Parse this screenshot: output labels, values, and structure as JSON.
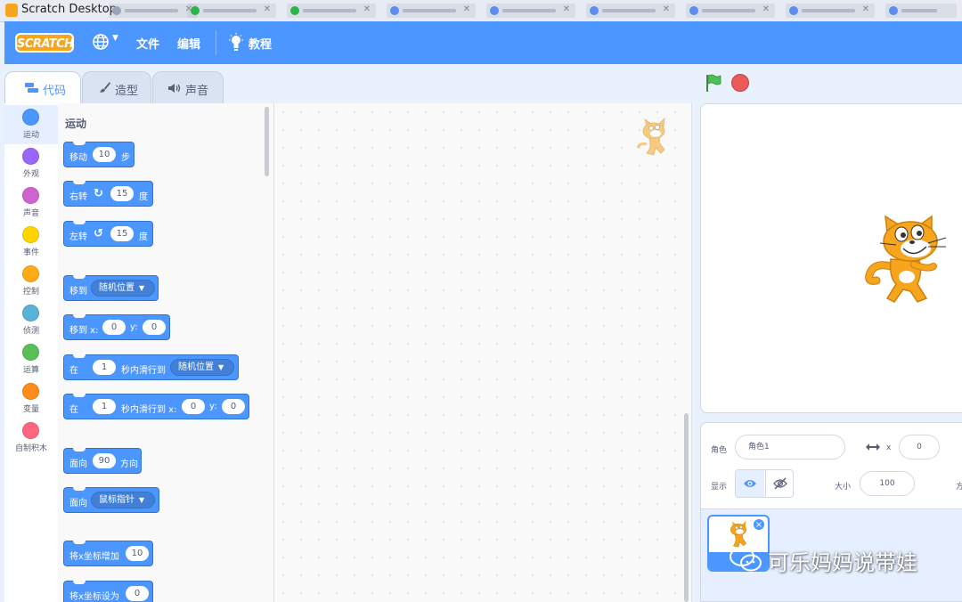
{
  "window": {
    "title": "Scratch Desktop"
  },
  "menubar": {
    "logo": "SCRATCH",
    "file": "文件",
    "edit": "编辑",
    "tutorials": "教程"
  },
  "tabs": [
    {
      "label": "代码",
      "active": true
    },
    {
      "label": "造型",
      "active": false
    },
    {
      "label": "声音",
      "active": false
    }
  ],
  "categories": [
    {
      "label": "运动",
      "color": "#4c97ff",
      "active": true
    },
    {
      "label": "外观",
      "color": "#9966ff"
    },
    {
      "label": "声音",
      "color": "#cf63cf"
    },
    {
      "label": "事件",
      "color": "#ffd500"
    },
    {
      "label": "控制",
      "color": "#ffab19"
    },
    {
      "label": "侦测",
      "color": "#5cb1d6"
    },
    {
      "label": "运算",
      "color": "#59c059"
    },
    {
      "label": "变量",
      "color": "#ff8c1a"
    },
    {
      "label": "自制积木",
      "color": "#ff6680"
    }
  ],
  "flyout": {
    "title": "运动",
    "blocks": {
      "move": {
        "a": "移动",
        "v": "10",
        "b": "步"
      },
      "turn_right": {
        "a": "右转",
        "v": "15",
        "b": "度"
      },
      "turn_left": {
        "a": "左转",
        "v": "15",
        "b": "度"
      },
      "goto": {
        "a": "移到",
        "d": "随机位置"
      },
      "goto_xy": {
        "a": "移到 x:",
        "x": "0",
        "ylab": "y:",
        "y": "0"
      },
      "glide": {
        "a": "在",
        "v": "1",
        "b": "秒内滑行到",
        "d": "随机位置"
      },
      "glide_xy": {
        "a": "在",
        "v": "1",
        "b": "秒内滑行到 x:",
        "x": "0",
        "ylab": "y:",
        "y": "0"
      },
      "point_dir": {
        "a": "面向",
        "v": "90",
        "b": "方向"
      },
      "point_towards": {
        "a": "面向",
        "d": "鼠标指针"
      },
      "change_x": {
        "a": "将x坐标增加",
        "v": "10"
      },
      "set_x": {
        "a": "将x坐标设为",
        "v": "0"
      }
    }
  },
  "sprite_info": {
    "sprite_label": "角色",
    "sprite_name": "角色1",
    "x_label": "x",
    "x_value": "0",
    "show_label": "显示",
    "size_label": "大小",
    "size_value": "100",
    "direction_label_partial": "方"
  },
  "watermark": "可乐妈妈说带娃"
}
